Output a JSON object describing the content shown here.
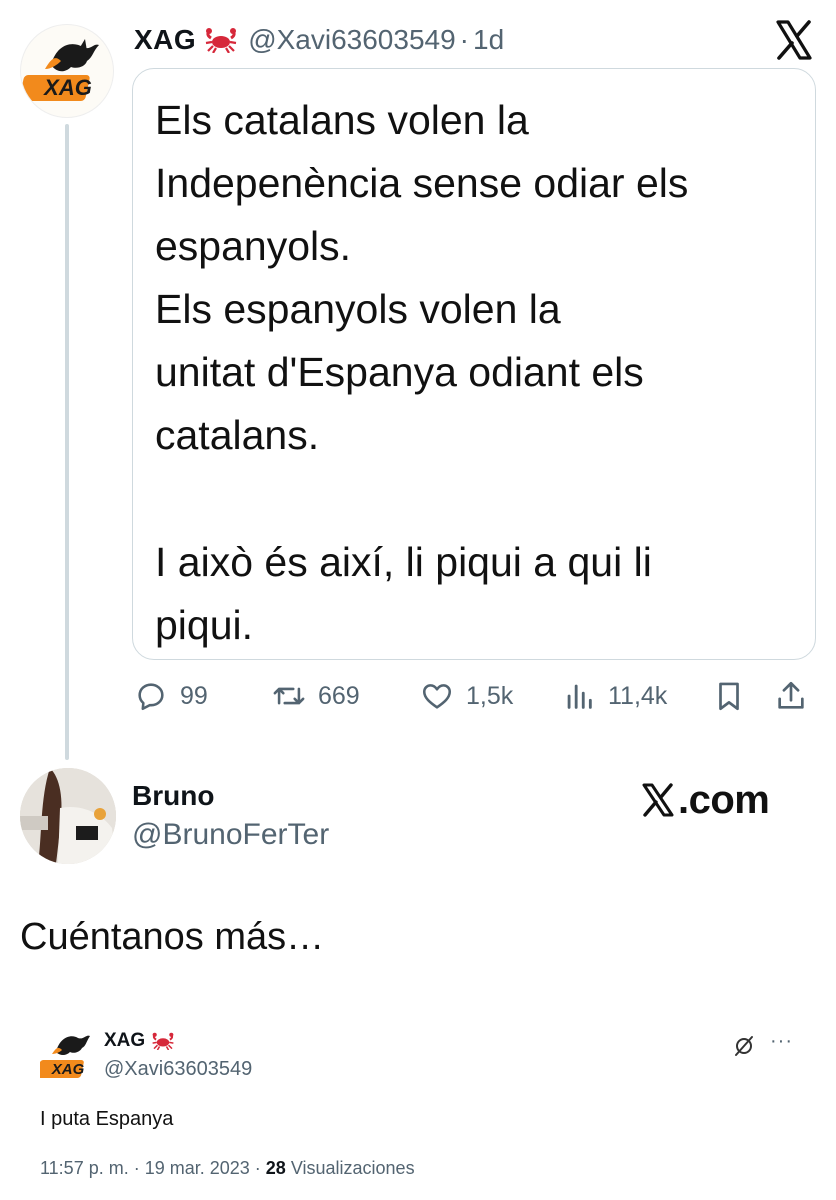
{
  "tweet": {
    "author_name": "XAG",
    "author_handle": "@Xavi63603549",
    "dot": "·",
    "time": "1d",
    "logo_text": "XAG",
    "media_text": [
      "Els catalans volen la",
      "Indepenència sense odiar els",
      "espanyols.",
      "Els espanyols volen la",
      "unitat d'Espanya odiant els",
      "catalans.",
      "",
      "I això és així, li piqui a qui li",
      "piqui."
    ],
    "actions": {
      "replies": "99",
      "reposts": "669",
      "likes": "1,5k",
      "views": "11,4k"
    }
  },
  "reply": {
    "author_name": "Bruno",
    "author_handle": "@BrunoFerTer",
    "watermark": ".com",
    "text": "Cuéntanos más…"
  },
  "embedded": {
    "author_name": "XAG",
    "author_handle": "@Xavi63603549",
    "logo_text": "XAG",
    "more": "···",
    "text": "I puta Espanya",
    "timestamp": "11:57 p. m. · 19 mar. 2023 · ",
    "views_count": "28",
    "views_label": " Visualizaciones"
  },
  "colors": {
    "text": "#0f1419",
    "muted": "#536471",
    "border": "#cfd9de",
    "crab": "#d6283a",
    "logo_orange": "#f28a1c"
  },
  "icons": [
    "crab-icon",
    "x-logo-icon",
    "reply-icon",
    "repost-icon",
    "like-icon",
    "views-icon",
    "bookmark-icon",
    "share-icon",
    "broken-link-icon"
  ]
}
